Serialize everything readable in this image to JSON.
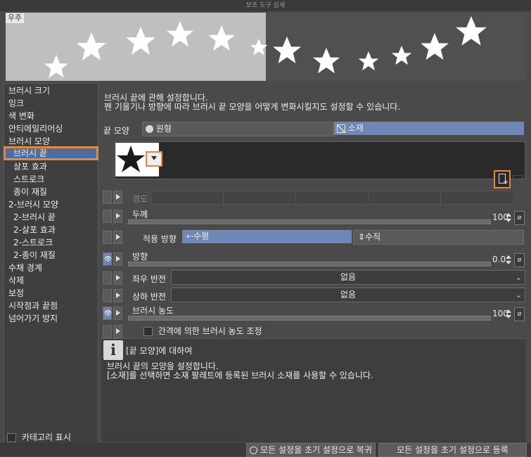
{
  "window": {
    "title": "보조 도구 상세"
  },
  "preview": {
    "tag": "우주"
  },
  "sidebar": {
    "items": [
      {
        "label": "브러시 크기"
      },
      {
        "label": "잉크"
      },
      {
        "label": "색 변화"
      },
      {
        "label": "안티에일리어싱"
      },
      {
        "label": "브러시 모양"
      },
      {
        "label": "브러시 끝"
      },
      {
        "label": "살포 효과"
      },
      {
        "label": "스트로크"
      },
      {
        "label": "종이 재질"
      },
      {
        "label": "2-브러시 모양"
      },
      {
        "label": "2-브러시 끝"
      },
      {
        "label": "2-살포 효과"
      },
      {
        "label": "2-스트로크"
      },
      {
        "label": "2-종이 재질"
      },
      {
        "label": "수채 경계"
      },
      {
        "label": "삭제"
      },
      {
        "label": "보정"
      },
      {
        "label": "시작점과 끝점"
      },
      {
        "label": "넘어가기 방지"
      }
    ],
    "selected": "브러시 끝",
    "show_categories": "카테고리 표시"
  },
  "main": {
    "desc_line1": "브러시 끝에 관해 설정합니다.",
    "desc_line2": "펜 기울기나 방향에 따라 브러시 끝 모양을 어떻게 변화시킬지도 설정할 수 있습니다.",
    "tip_shape": {
      "label": "끝 모양",
      "option_circle": "원형",
      "option_material": "소재"
    },
    "hardness": {
      "label": "경도"
    },
    "thickness": {
      "label": "두께",
      "value": "100"
    },
    "apply_direction": {
      "label": "적용 방향",
      "horizontal": "수평",
      "vertical": "수직"
    },
    "direction": {
      "label": "방향",
      "value": "0.0"
    },
    "flip_horizontal": {
      "label": "좌우 반전",
      "value": "없음"
    },
    "flip_vertical": {
      "label": "상하 반전",
      "value": "없음"
    },
    "brush_density": {
      "label": "브러시 농도",
      "value": "100"
    },
    "density_by_interval": {
      "label": "간격에 의한 브러시 농도 조정"
    }
  },
  "info": {
    "title": "[끝 모양]에 대하여",
    "line1": "브러시 끝의 모양을 설정합니다.",
    "line2": "[소재]를 선택하면 소재 팔레트에 등록된 브러시 소재를 사용할 수 있습니다."
  },
  "bottom": {
    "restore_label": "모든 설정을 초기 설정으로 복귀",
    "register_label": "모든 설정을 초기 설정으로 등록"
  },
  "colors": {
    "accent": "#6f86b6",
    "highlight": "#e8893a"
  }
}
